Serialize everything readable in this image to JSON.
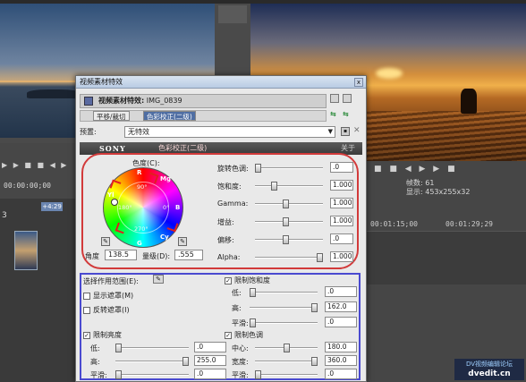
{
  "background": {
    "left_timecode": "00:00:00;00",
    "left_marker": "+4:29",
    "track_number": "3",
    "right_frame": "帧数: 61",
    "right_display": "显示: 453x255x32",
    "right_timecode_1": "00:01:15;00",
    "right_timecode_2": "00:01:29;29",
    "watermark_line1": "DV视频编辑论坛",
    "watermark_url": "dvedit.cn"
  },
  "dialog": {
    "title": "视频素材特效",
    "close_glyph": "x",
    "fx_prefix": "视频素材特效:",
    "fx_file": "IMG_0839",
    "chain": [
      "平移/裁切",
      "色彩校正(二级)"
    ],
    "preset_label": "预置:",
    "preset_value": "无特效",
    "plugin_brand": "SONY",
    "plugin_title": "色彩校正(二级)",
    "about": "关于",
    "hue_label": "色度(C):",
    "wheel_letters": {
      "r": "R",
      "mg": "Mg",
      "b": "B",
      "cy": "Cy",
      "g": "G",
      "yl": "Yl"
    },
    "wheel_degrees": {
      "d90": "90°",
      "d0": "0°",
      "d180": "180°",
      "d270": "270°"
    },
    "angle_label": "角度",
    "angle_value": "138.5",
    "magnitude_label": "量级(D):",
    "magnitude_value": ".555",
    "sliders": [
      {
        "label": "旋转色调:",
        "value": ".0",
        "level": 0.03
      },
      {
        "label": "饱和度:",
        "value": "1.000",
        "level": 0.28
      },
      {
        "label": "Gamma:",
        "value": "1.000",
        "level": 0.45
      },
      {
        "label": "增益:",
        "value": "1.000",
        "level": 0.45
      },
      {
        "label": "偏移:",
        "value": ".0",
        "level": 0.45
      },
      {
        "label": "Alpha:",
        "value": "1.000",
        "level": 0.98
      }
    ],
    "select_range_label": "选择作用范围(E):",
    "show_mask": "显示遮罩(M)",
    "invert_mask": "反转遮罩(I)",
    "limit_saturation": {
      "title": "限制饱和度",
      "low_label": "低:",
      "low_value": ".0",
      "low_level": 0.0,
      "high_label": "高:",
      "high_value": "162.0",
      "high_level": 0.98,
      "smooth_label": "平滑:",
      "smooth_value": ".0",
      "smooth_level": 0.0
    },
    "limit_luminance": {
      "title": "限制亮度",
      "low_label": "低:",
      "low_value": ".0",
      "low_level": 0.0,
      "high_label": "高:",
      "high_value": "255.0",
      "high_level": 0.98,
      "smooth_label": "平滑:",
      "smooth_value": ".0",
      "smooth_level": 0.0
    },
    "limit_hue": {
      "title": "限制色调",
      "center_label": "中心:",
      "center_value": "180.0",
      "center_level": 0.5,
      "width_label": "宽度:",
      "width_value": "360.0",
      "width_level": 0.98,
      "smooth_label": "平滑:",
      "smooth_value": ".0",
      "smooth_level": 0.0
    }
  }
}
